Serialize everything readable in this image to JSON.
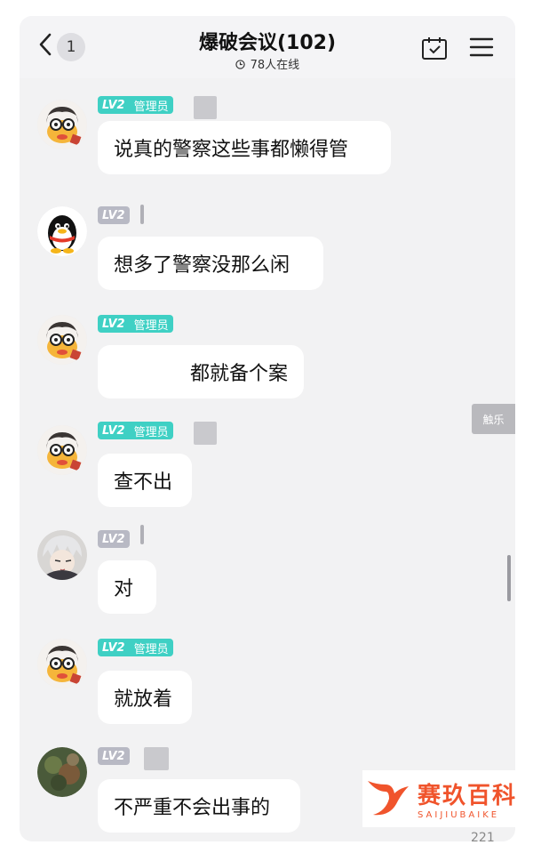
{
  "header": {
    "unread_count": "1",
    "title": "爆破会议(102)",
    "online_icon": "clock-icon",
    "online_text": "78人在线",
    "calendar_icon": "calendar-check-icon",
    "menu_icon": "hamburger-menu-icon"
  },
  "colors": {
    "admin_tag": "#3fd0c4",
    "member_tag": "#b8b9c4",
    "bubble": "#ffffff",
    "background": "#f2f2f3"
  },
  "messages": [
    {
      "level": "LV2",
      "role": "管理员",
      "text": "说真的警察这些事都懒得管"
    },
    {
      "level": "LV2",
      "role": "",
      "text": "想多了警察没那么闲"
    },
    {
      "level": "LV2",
      "role": "管理员",
      "text": "都就备个案"
    },
    {
      "level": "LV2",
      "role": "管理员",
      "text": "查不出"
    },
    {
      "level": "LV2",
      "role": "",
      "text": "对"
    },
    {
      "level": "LV2",
      "role": "管理员",
      "text": "就放着"
    },
    {
      "level": "LV2",
      "role": "",
      "text": "不严重不会出事的"
    }
  ],
  "side_tab": "触乐",
  "watermark": {
    "logo_icon": "whale-tail-logo-icon",
    "name_cn": "赛玖百科",
    "name_en": "SAIJIUBAIKE"
  },
  "page_number": "221"
}
